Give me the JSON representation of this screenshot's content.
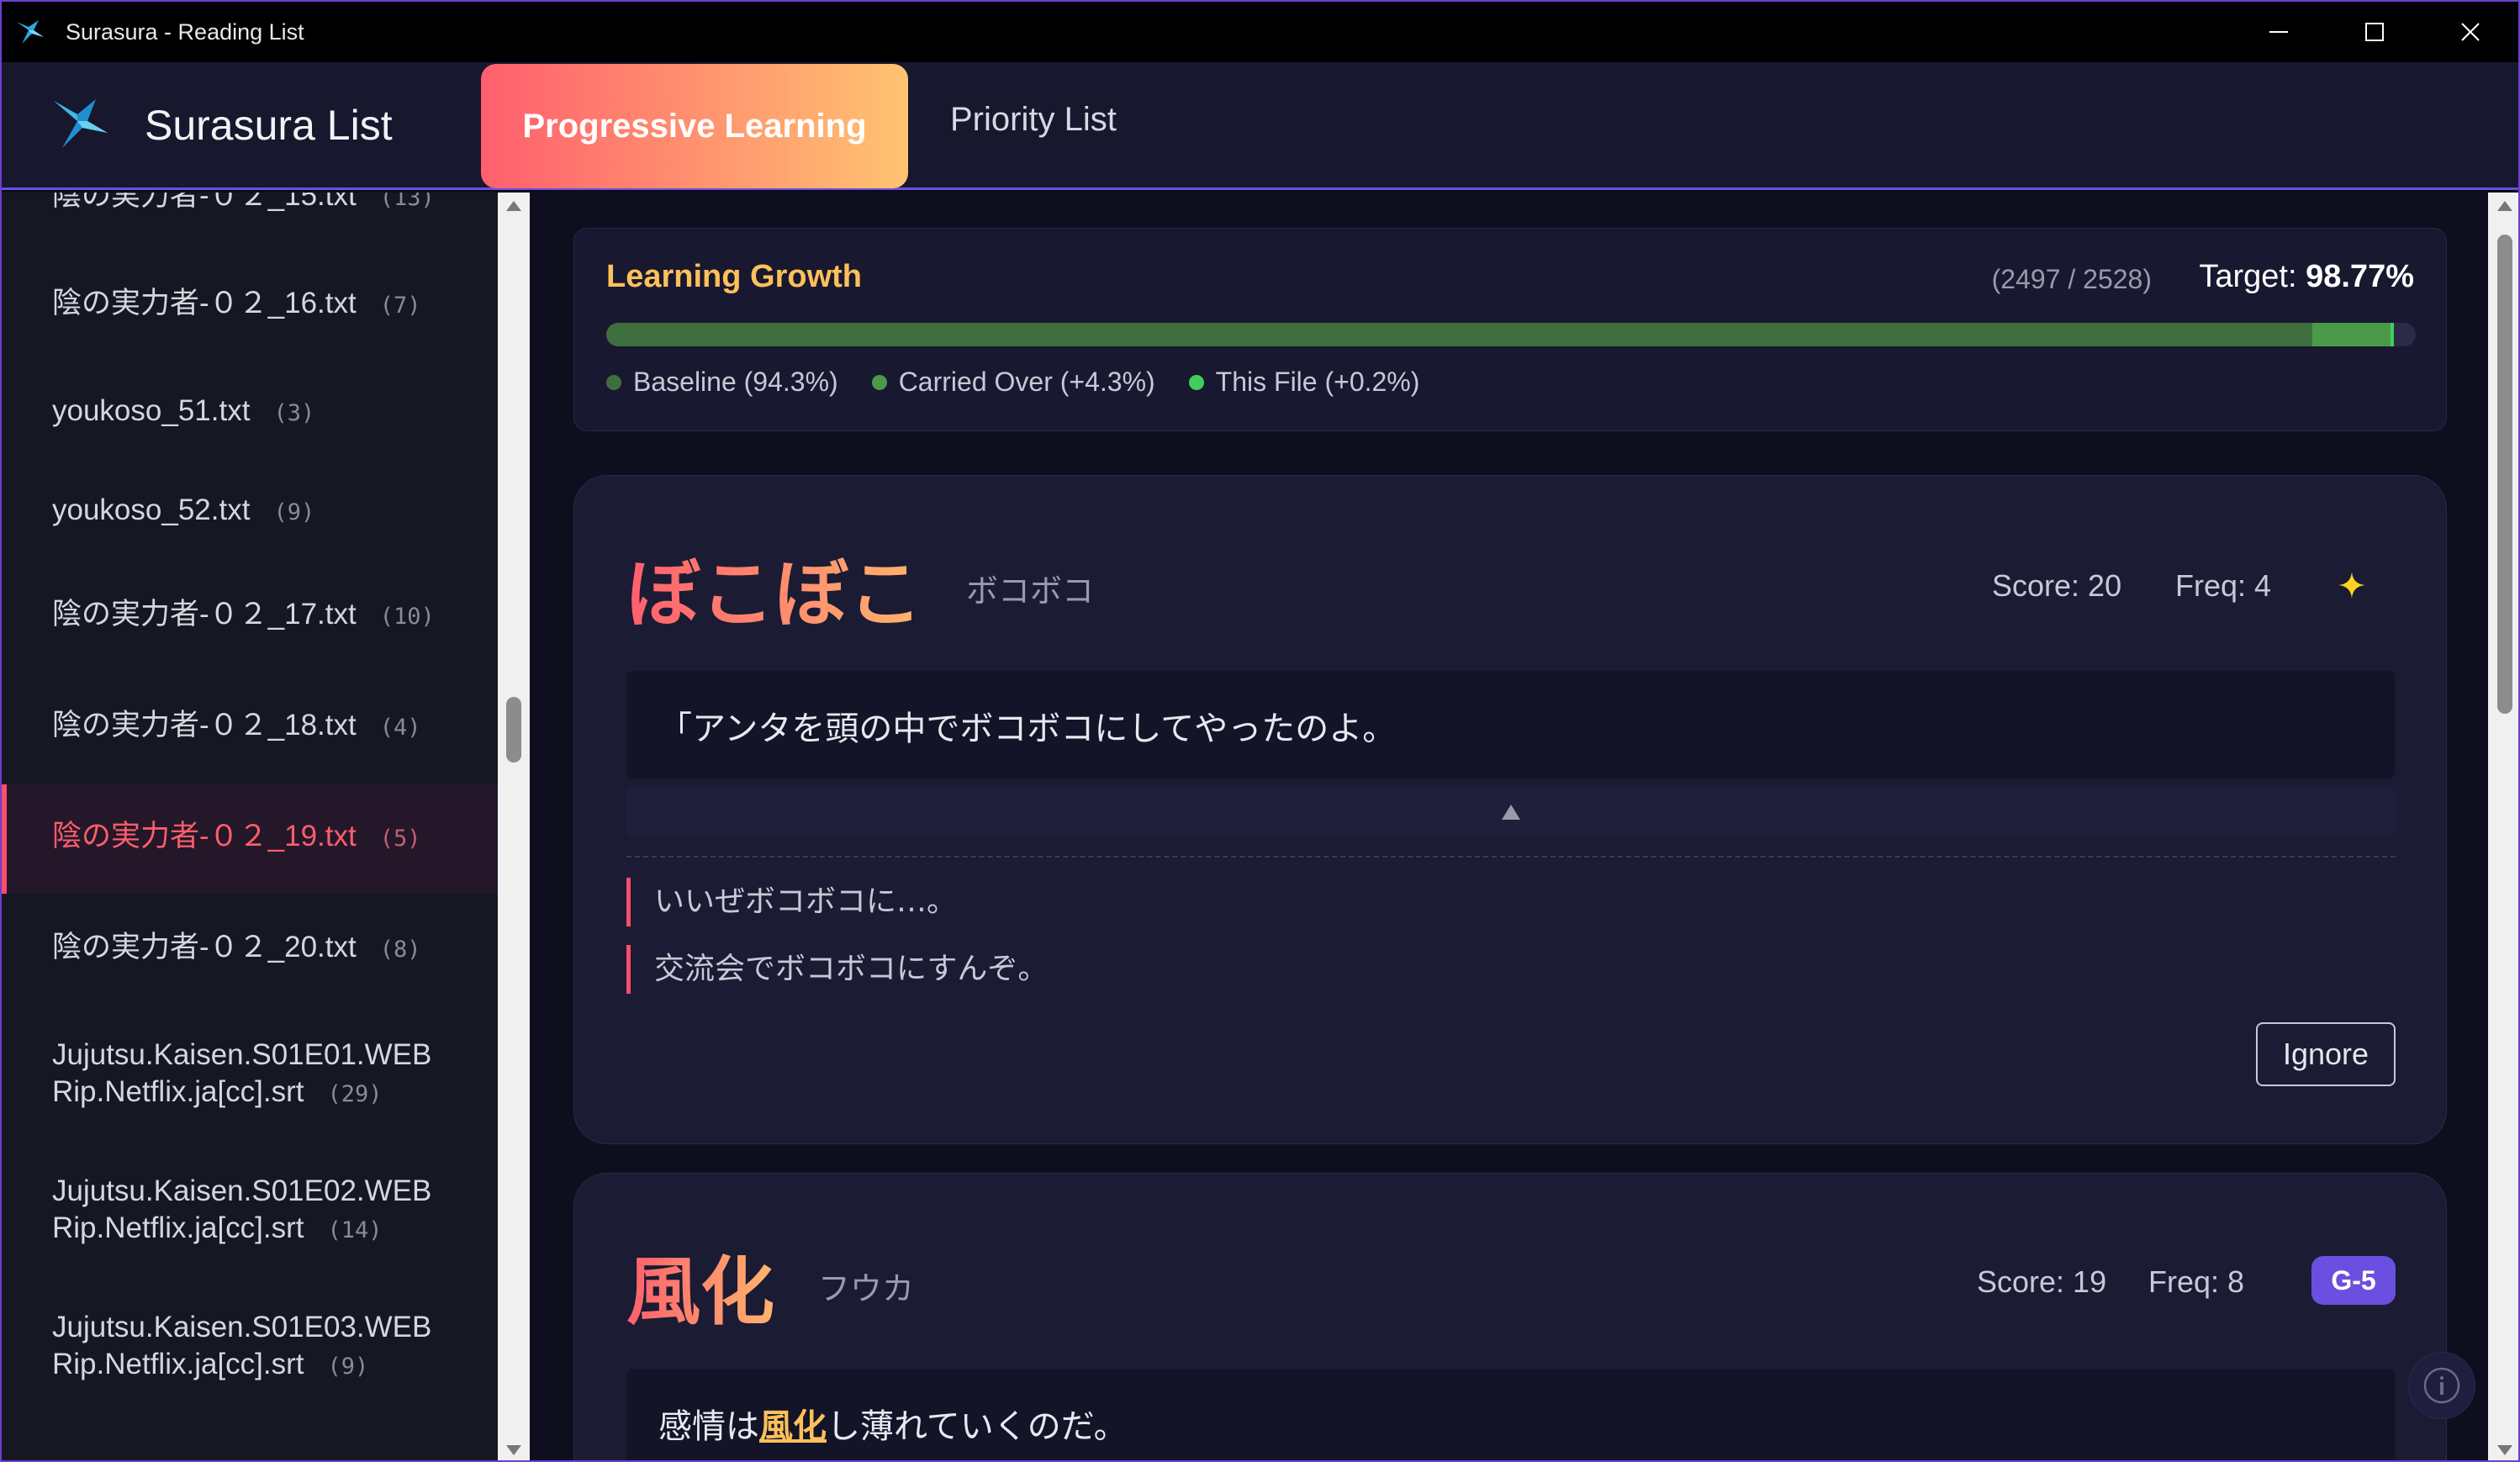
{
  "window": {
    "title": "Surasura - Reading List"
  },
  "header": {
    "brand": "Surasura List",
    "tabs": [
      {
        "label": "Progressive Learning",
        "active": true
      },
      {
        "label": "Priority List",
        "active": false
      }
    ]
  },
  "sidebar": {
    "items": [
      {
        "name": "陰の実力者-０２_15.txt",
        "count": "(13)",
        "active": false
      },
      {
        "name": "陰の実力者-０２_16.txt",
        "count": "(7)",
        "active": false
      },
      {
        "name": "youkoso_51.txt",
        "count": "(3)",
        "active": false
      },
      {
        "name": "youkoso_52.txt",
        "count": "(9)",
        "active": false
      },
      {
        "name": "陰の実力者-０２_17.txt",
        "count": "(10)",
        "active": false
      },
      {
        "name": "陰の実力者-０２_18.txt",
        "count": "(4)",
        "active": false
      },
      {
        "name": "陰の実力者-０２_19.txt",
        "count": "(5)",
        "active": true
      },
      {
        "name": "陰の実力者-０２_20.txt",
        "count": "(8)",
        "active": false
      },
      {
        "name_line1": "Jujutsu.Kaisen.S01E01.WEB",
        "name_line2": "Rip.Netflix.ja[cc].srt",
        "count": "(29)",
        "active": false
      },
      {
        "name_line1": "Jujutsu.Kaisen.S01E02.WEB",
        "name_line2": "Rip.Netflix.ja[cc].srt",
        "count": "(14)",
        "active": false
      },
      {
        "name_line1": "Jujutsu.Kaisen.S01E03.WEB",
        "name_line2": "Rip.Netflix.ja[cc].srt",
        "count": "(9)",
        "active": false
      }
    ]
  },
  "growth": {
    "title": "Learning Growth",
    "count": "(2497 / 2528)",
    "target_label": "Target:",
    "target_value": "98.77%",
    "segments": [
      {
        "label": "Baseline (94.3%)",
        "fraction": 0.943,
        "color": "#3f6e3f"
      },
      {
        "label": "Carried Over (+4.3%)",
        "fraction": 0.043,
        "color": "#4a9a4a"
      },
      {
        "label": "This File (+0.2%)",
        "fraction": 0.002,
        "color": "#3fd05a"
      }
    ]
  },
  "cards": [
    {
      "word": "ぼこぼこ",
      "reading": "ボコボコ",
      "score": "Score: 20",
      "freq": "Freq: 4",
      "sentence": "「アンタを頭の中でボコボコにしてやったのよ。",
      "examples": [
        "いいぜボコボコに…。",
        "交流会でボコボコにすんぞ。"
      ],
      "ignore_label": "Ignore",
      "icon": "sparkle-icon",
      "accent": "#ffd21f"
    },
    {
      "word": "風化",
      "reading": "フウカ",
      "score": "Score: 19",
      "freq": "Freq: 8",
      "grade": "G-5",
      "sentence_pre": "感情は",
      "sentence_hl": "風化",
      "sentence_post": "し薄れていくのだ。"
    }
  ],
  "colors": {
    "accent_gradient_start": "#ff5f6d",
    "accent_gradient_end": "#ffc371",
    "active_red": "#ff5d6a",
    "grade_purple": "#6b4fe0",
    "growth_title": "#ffc05a"
  }
}
